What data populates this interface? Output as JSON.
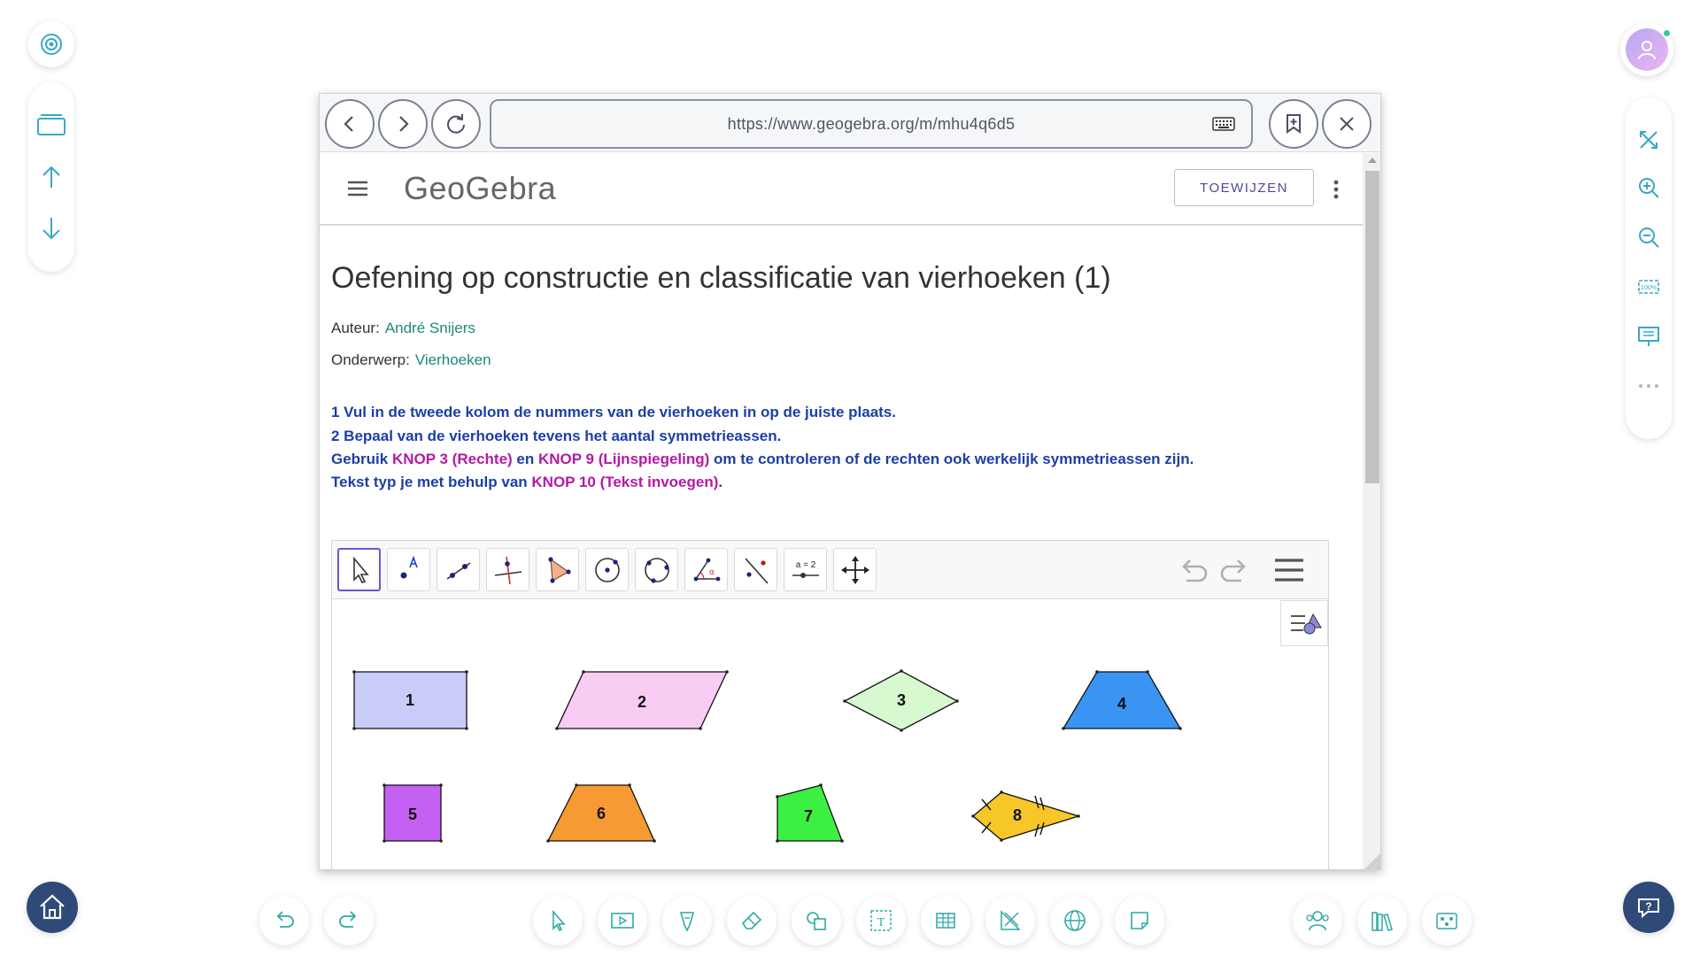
{
  "browser": {
    "url": "https://www.geogebra.org/m/mhu4q6d5"
  },
  "geogebra": {
    "logo": "GeoGebra",
    "assign_button": "TOEWIJZEN",
    "title": "Oefening op constructie en classificatie van vierhoeken (1)",
    "author_label": "Auteur:",
    "author_name": "André Snijers",
    "topic_label": "Onderwerp:",
    "topic_name": "Vierhoeken",
    "instructions": {
      "line1": "1 Vul in de tweede kolom de nummers van de vierhoeken in op de juiste plaats.",
      "line2": "2 Bepaal van de vierhoeken tevens het aantal symmetrieassen.",
      "line3_a": "Gebruik ",
      "line3_b": "KNOP 3 (Rechte)",
      "line3_c": " en ",
      "line3_d": "KNOP 9 (Lijnspiegeling)",
      "line3_e": " om te controleren of de rechten ook werkelijk symmetrieassen zijn.",
      "line4_a": "Tekst typ je met behulp van ",
      "line4_b": "KNOP 10 (Tekst invoegen)",
      "line4_c": "."
    },
    "slider_tool_label": "a = 2",
    "shapes": [
      {
        "label": "1",
        "color": "#c9ccf8"
      },
      {
        "label": "2",
        "color": "#f9ccf4"
      },
      {
        "label": "3",
        "color": "#d6f9cf"
      },
      {
        "label": "4",
        "color": "#3b94f2"
      },
      {
        "label": "5",
        "color": "#c460f2"
      },
      {
        "label": "6",
        "color": "#f79a33"
      },
      {
        "label": "7",
        "color": "#3cf043"
      },
      {
        "label": "8",
        "color": "#f7c72a"
      }
    ]
  },
  "colors": {
    "accent_teal": "#2fa9a5",
    "instruction_blue": "#1b3fa6",
    "instruction_pink": "#b41aa5",
    "home_button": "#2f4a78"
  }
}
